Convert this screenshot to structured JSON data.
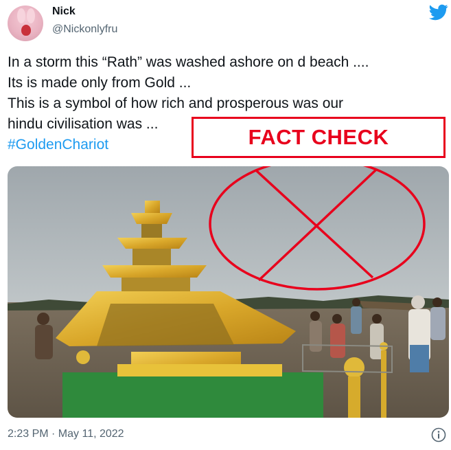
{
  "user": {
    "name": "Nick",
    "handle": "@Nickonlyfru"
  },
  "tweet": {
    "lines": [
      "In a storm this “Rath” was washed ashore on d beach ....",
      "Its is made only from Gold ...",
      "This is a symbol of how rich and prosperous was our",
      "hindu civilisation was ..."
    ],
    "hashtag": "#GoldenChariot"
  },
  "overlay": {
    "label": "FACT CHECK",
    "color": "#e8001c"
  },
  "meta": {
    "timestamp": "2:23 PM · May 11, 2022"
  },
  "icons": {
    "brand": "twitter-bird-icon",
    "info": "info-icon"
  },
  "colors": {
    "link": "#1d9bf0",
    "secondary_text": "#536471",
    "twitter_blue": "#1d9bf0"
  }
}
